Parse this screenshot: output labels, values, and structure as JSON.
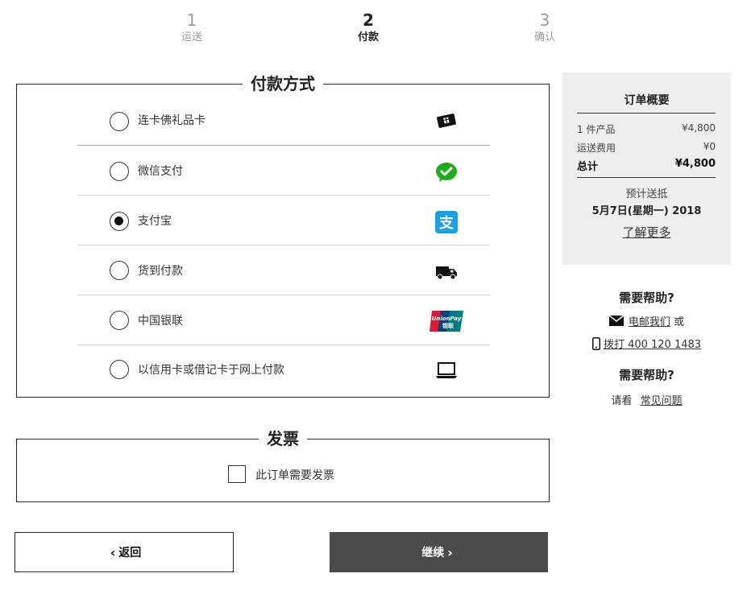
{
  "stepper": {
    "steps": [
      {
        "num": "1",
        "label": "运送"
      },
      {
        "num": "2",
        "label": "付款"
      },
      {
        "num": "3",
        "label": "确认"
      }
    ]
  },
  "payment": {
    "title": "付款方式",
    "methods": [
      {
        "label": "连卡佛礼品卡",
        "icon": "gift-card-icon",
        "selected": false
      },
      {
        "label": "微信支付",
        "icon": "wechat-pay-icon",
        "selected": false
      },
      {
        "label": "支付宝",
        "icon": "alipay-icon",
        "selected": true
      },
      {
        "label": "货到付款",
        "icon": "delivery-truck-icon",
        "selected": false
      },
      {
        "label": "中国银联",
        "icon": "unionpay-icon",
        "selected": false
      },
      {
        "label": "以信用卡或借记卡于网上付款",
        "icon": "laptop-icon",
        "selected": false
      }
    ]
  },
  "invoice": {
    "title": "发票",
    "checkbox_label": "此订单需要发票"
  },
  "buttons": {
    "back": "返回",
    "next": "继续"
  },
  "summary": {
    "title": "订单概要",
    "items_label": "1 件产品",
    "items_value": "¥4,800",
    "shipping_label": "运送费用",
    "shipping_value": "¥0",
    "total_label": "总计",
    "total_value": "¥4,800",
    "delivery_label": "预计送抵",
    "delivery_date": "5月7日(星期一) 2018",
    "learn_more": "了解更多"
  },
  "help": {
    "title1": "需要帮助?",
    "email_link": "电邮我们",
    "or": "或",
    "phone_link": "拨打 400 120 1483",
    "title2": "需要帮助?",
    "see": "请看",
    "faq_link": "常见问题"
  },
  "colors": {
    "wechat": "#1aad19",
    "alipay": "#1aa0e4",
    "next_button": "#4a4a4a",
    "summary_bg": "#efeded"
  }
}
